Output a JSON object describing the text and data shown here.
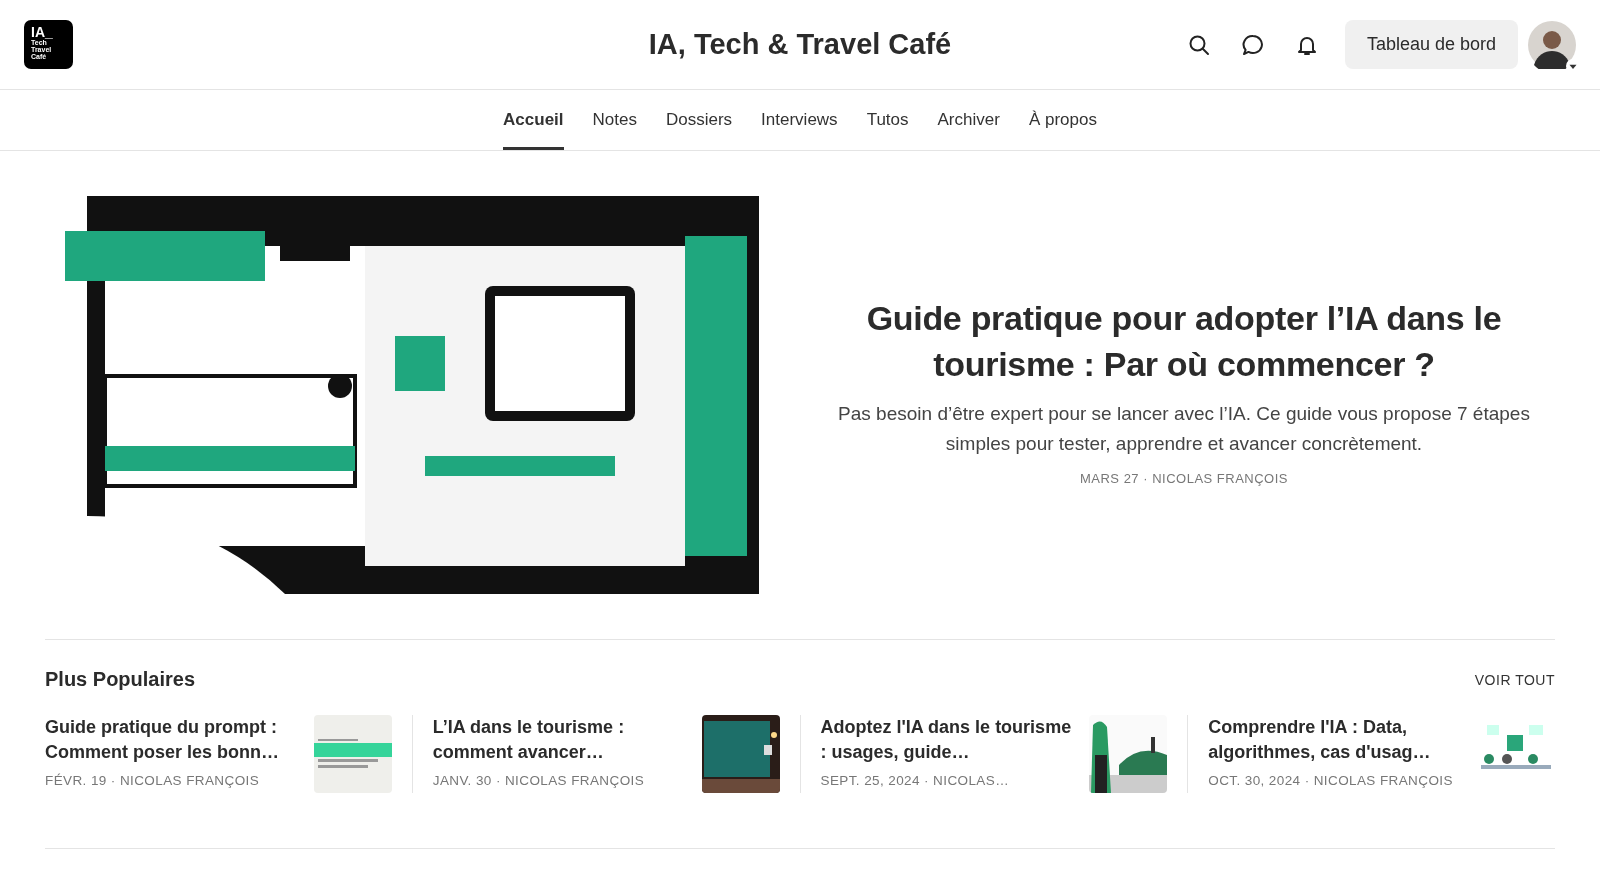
{
  "header": {
    "logo_lines": [
      "IA_",
      "Tech",
      "Travel",
      "Café"
    ],
    "title": "IA, Tech & Travel Café",
    "dashboard_button": "Tableau de bord"
  },
  "nav": [
    {
      "label": "Accueil",
      "selected": true
    },
    {
      "label": "Notes",
      "selected": false
    },
    {
      "label": "Dossiers",
      "selected": false
    },
    {
      "label": "Interviews",
      "selected": false
    },
    {
      "label": "Tutos",
      "selected": false
    },
    {
      "label": "Archiver",
      "selected": false
    },
    {
      "label": "À propos",
      "selected": false
    }
  ],
  "featured": {
    "title": "Guide pratique pour adopter l’IA dans le tourisme : Par où commencer ?",
    "subtitle": "Pas besoin d’être expert pour se lancer avec l’IA. Ce guide vous propose 7 étapes simples pour tester, apprendre et avancer concrètement.",
    "meta": "MARS 27 · NICOLAS FRANÇOIS"
  },
  "popular": {
    "heading": "Plus Populaires",
    "see_all": "VOIR TOUT",
    "posts": [
      {
        "title": "Guide pratique du prompt : Comment poser les bonn…",
        "meta": "FÉVR. 19 · NICOLAS FRANÇOIS"
      },
      {
        "title": "L’IA dans le tourisme : comment avancer…",
        "meta": "JANV. 30 · NICOLAS FRANÇOIS"
      },
      {
        "title": "Adoptez l'IA dans le tourisme : usages, guide…",
        "meta": "SEPT. 25, 2024 · NICOLAS…"
      },
      {
        "title": "Comprendre l'IA : Data, algorithmes, cas d'usag…",
        "meta": "OCT. 30, 2024 · NICOLAS FRANÇOIS"
      }
    ]
  }
}
